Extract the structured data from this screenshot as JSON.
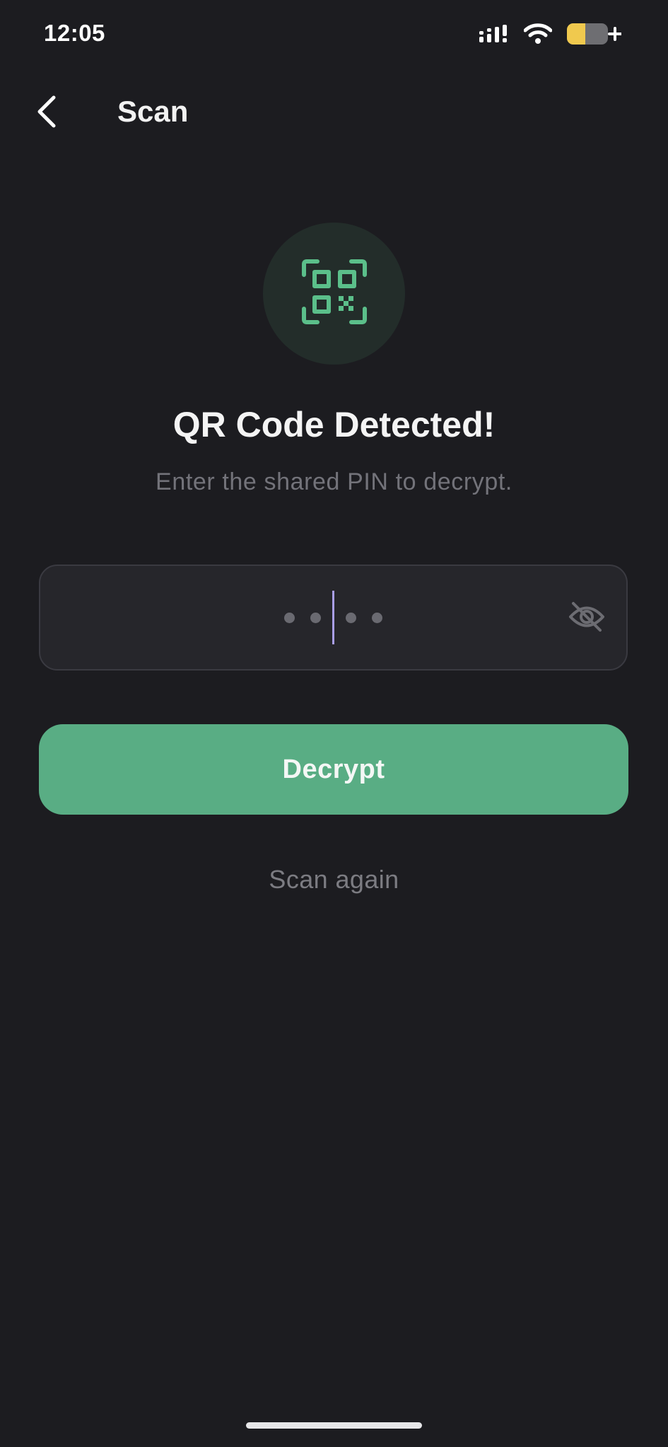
{
  "status_bar": {
    "time": "12:05",
    "icons": [
      "cellular-signal-icon",
      "wifi-icon",
      "battery-charging-icon"
    ]
  },
  "header": {
    "back_icon": "chevron-left-icon",
    "title": "Scan"
  },
  "hero": {
    "icon": "qr-code-icon",
    "title": "QR Code Detected!",
    "subtitle": "Enter the shared PIN to decrypt."
  },
  "pin_input": {
    "dot_count": 4,
    "visibility_icon": "eye-off-icon"
  },
  "actions": {
    "decrypt_label": "Decrypt",
    "scan_again_label": "Scan again"
  },
  "colors": {
    "background": "#1c1c20",
    "accent": "#59ad84",
    "qr_icon": "#5bbf8a",
    "input_background": "#26262b",
    "caret": "#a99ee8",
    "battery": "#f0c94e"
  }
}
